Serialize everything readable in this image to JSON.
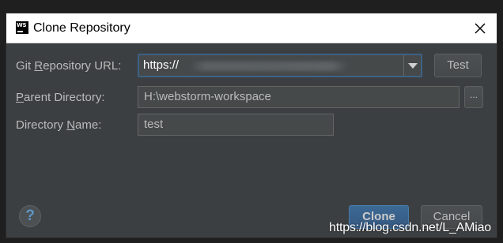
{
  "window": {
    "title": "Clone Repository",
    "app_icon_text": "WS"
  },
  "form": {
    "url_label_before": "Git ",
    "url_label_mnemonic": "R",
    "url_label_after": "epository URL:",
    "url_value": "https://",
    "test_button": "Test",
    "parent_label_mnemonic": "P",
    "parent_label_after": "arent Directory:",
    "parent_value": "H:\\webstorm-workspace",
    "browse_button": "...",
    "name_label_before": "Directory ",
    "name_label_mnemonic": "N",
    "name_label_after": "ame:",
    "name_value": "test"
  },
  "footer": {
    "help_button": "?",
    "clone_button": "Clone",
    "cancel_button": "Cancel"
  },
  "watermark": "https://blog.csdn.net/L_AMiao",
  "colors": {
    "dialog_background": "#3c3f41",
    "title_bar": "#ffffff",
    "focus_border": "#3d6185",
    "default_button": "#365880",
    "help_icon": "#5c95c7"
  },
  "icons": {
    "close": "close-icon",
    "dropdown": "chevron-down-icon",
    "help": "help-icon",
    "app": "webstorm-icon"
  }
}
